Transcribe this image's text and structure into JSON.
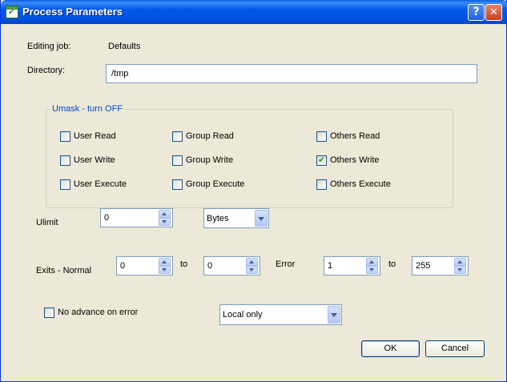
{
  "window": {
    "title": "Process Parameters"
  },
  "titlebar": {
    "help_label": "?",
    "close_label": "✕"
  },
  "job": {
    "label": "Editing job:",
    "value": "Defaults"
  },
  "directory": {
    "label": "Directory:",
    "value": "/tmp"
  },
  "umask": {
    "title": "Umask - turn OFF",
    "user": [
      "User Read",
      "User Write",
      "User Execute"
    ],
    "group": [
      "Group Read",
      "Group Write",
      "Group Execute"
    ],
    "others": [
      "Others Read",
      "Others Write",
      "Others Execute"
    ],
    "checked": [
      "Others Write"
    ]
  },
  "ulimit": {
    "label": "Ulimit",
    "value": "0",
    "unit": "Bytes"
  },
  "exits": {
    "label": "Exits - Normal",
    "normal_from": "0",
    "to_label": "to",
    "normal_to": "0",
    "error_label": "Error",
    "error_from": "1",
    "error_to_label": "to",
    "error_to": "255"
  },
  "advance": {
    "label": "No advance on error",
    "checked": false
  },
  "scope": {
    "value": "Local only"
  },
  "buttons": {
    "ok": "OK",
    "cancel": "Cancel"
  },
  "colors": {
    "title_bar": "#0054e3",
    "dialog_bg": "#ece9d8",
    "group_title": "#0046d5",
    "check_mark": "#21a121"
  }
}
